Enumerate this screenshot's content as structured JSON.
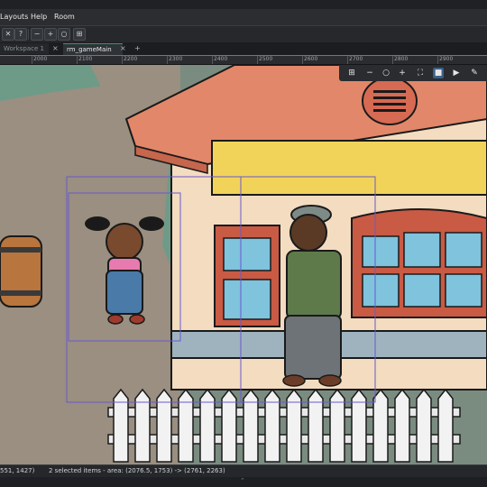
{
  "menu": [
    "Layouts",
    "Help",
    "Room"
  ],
  "tabs": [
    {
      "label": "Workspace 1",
      "active": false
    },
    {
      "label": "rm_gameMain",
      "active": true
    }
  ],
  "tab_add": "+",
  "tab_close": "×",
  "ruler": [
    "2000",
    "2100",
    "2200",
    "2300",
    "2400",
    "2500",
    "2600",
    "2700",
    "2800",
    "2900"
  ],
  "toolbar_icons": [
    "close-icon",
    "help-icon",
    "zoom-out-icon",
    "zoom-in-icon",
    "zoom-reset-icon",
    "grid-icon"
  ],
  "viewport_tools": [
    "grid-toggle-icon",
    "zoom-out-icon",
    "zoom-reset-icon",
    "zoom-in-icon",
    "fit-icon",
    "stop-icon",
    "play-icon",
    "paint-icon"
  ],
  "status": {
    "cursor": "551, 1427)",
    "selection": "2 selected items - area: (2076.5, 1753) -> (2761, 2263)"
  },
  "colors": {
    "selection": "#6a5acd",
    "accent": "#2e9e5b",
    "roof": "#e2876a",
    "wall": "#f3dcc0",
    "sign": "#f2d35a",
    "path": "#9a8f80",
    "grass": "#6e9b88"
  }
}
